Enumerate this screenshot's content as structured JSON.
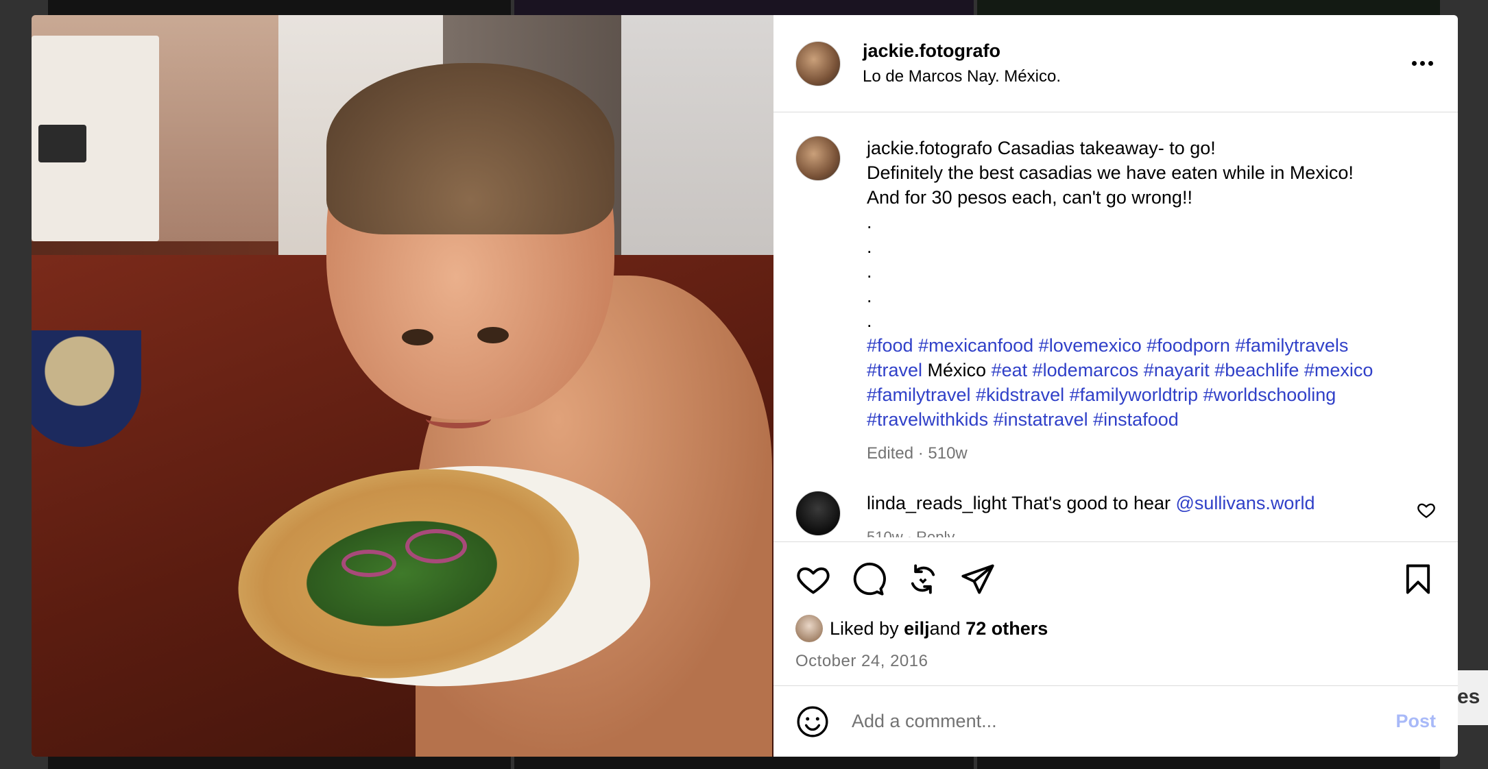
{
  "post": {
    "username": "jackie.fotografo",
    "location": "Lo de Marcos Nay. México.",
    "caption": {
      "username": "jackie.fotografo",
      "line1": "Casadias takeaway- to go!",
      "line2": "Definitely the best casadias we have eaten while in Mexico!",
      "line3": "And for 30 pesos each, can't go wrong!!",
      "dots": [
        ".",
        ".",
        ".",
        ".",
        "."
      ],
      "tags_line1": "#food #mexicanfood #lovemexico #foodporn #familytravels",
      "tags_line2a": "#travel",
      "tags_line2_plain": " México ",
      "tags_line2b": "#eat #lodemarcos #nayarit #beachlife #mexico",
      "tags_line3": "#familytravel #kidstravel #familyworldtrip #worldschooling",
      "tags_line4": "#travelwithkids #instatravel #instafood",
      "meta": "Edited · 510w"
    },
    "comment": {
      "username": "linda_reads_light",
      "text": " That's good to hear ",
      "mention": "@sullivans.world",
      "meta": "510w · Reply"
    },
    "likes": {
      "prefix": "Liked by ",
      "user": "eilj",
      "middle": " and ",
      "others": "72 others"
    },
    "date": "October 24, 2016",
    "add_comment": {
      "placeholder": "Add a comment...",
      "post_label": "Post"
    }
  },
  "background_peek_text": "es",
  "colors": {
    "hashtag": "#3040c8",
    "muted": "#737373",
    "post_disabled": "#a8b9f8"
  }
}
